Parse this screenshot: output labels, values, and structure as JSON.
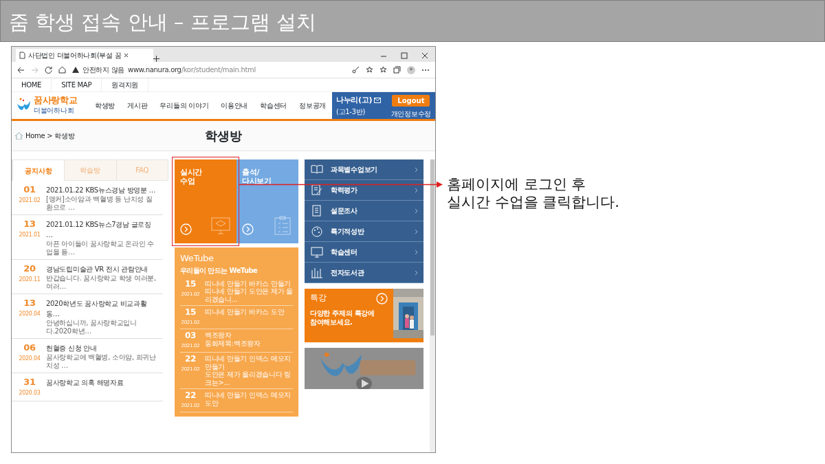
{
  "slide_title": "줌 학생 접속 안내 – 프로그램 설치",
  "callout": {
    "lines": [
      "홈페이지에 로그인 후",
      "실시간 수업을 클릭합니다."
    ]
  },
  "browser": {
    "tab_title": "사단법인 더불어하나회(부설 꿈",
    "security": "안전하지 않음",
    "url_host": "www.nanura.org",
    "url_path": "/kor/student/main.html"
  },
  "site": {
    "top_links": [
      "HOME",
      "SITE MAP",
      "원격지원"
    ],
    "logo": "꿈사랑학교",
    "logo_sub": "더불어하나회",
    "nav": [
      "학생방",
      "게시판",
      "우리들의 이야기",
      "이용안내",
      "학습센터",
      "정보공개"
    ],
    "user": {
      "name": "나누리(고)",
      "grade": "(고1-3반)",
      "logout": "Logout",
      "profile": "개인정보수정"
    }
  },
  "breadcrumb": {
    "home": "Home",
    "separator": ">",
    "current": "학생방"
  },
  "page_title": "학생방",
  "notice_tabs": [
    {
      "label": "공지사항",
      "selected": true
    },
    {
      "label": "학습방",
      "selected": false
    },
    {
      "label": "FAQ",
      "selected": false
    }
  ],
  "notices": [
    {
      "day": "01",
      "month": "2021.02",
      "title": "2021.01.22 KBS뉴스경남 방영분 …",
      "summary": "[앵커]소아암과 백혈병 등 난치성 질환으로 …"
    },
    {
      "day": "13",
      "month": "2021.01",
      "title": "2021.01.12 KBS뉴스7경남 글로징 …",
      "summary": "아픈 아이들이 꿈사랑학교 온라인 수업을 듣…"
    },
    {
      "day": "20",
      "month": "2020.11",
      "title": "경남도립미술관 VR 전시 관람안내",
      "summary": "반갑습니다. 꿈사랑학교 학생 여러분,  여러…"
    },
    {
      "day": "13",
      "month": "2020.04",
      "title": "2020학년도 꿈사랑학교 비교과활동…",
      "summary": "안녕하십니까, 꿈사랑학교입니다.2020학년…"
    },
    {
      "day": "06",
      "month": "2020.04",
      "title": "헌혈증 신청 안내",
      "summary": "꿈사랑학교에 백혈병, 소아암, 희귀난치성 …"
    },
    {
      "day": "31",
      "month": "2020.03",
      "title": "꿈사랑학교 의혹 해명자료"
    }
  ],
  "tiles": [
    {
      "title": "실시간\n수업",
      "kind": "live",
      "color": "#f07d0f",
      "highlighted": true
    },
    {
      "title": "출석/\n다시보기",
      "kind": "attendance",
      "color": "#74a9e1",
      "highlighted": false
    }
  ],
  "wetube": {
    "title": "WeTube",
    "subtitle": "우리들이 만드는 WeTube",
    "items": [
      {
        "day": "15",
        "month": "2021.02",
        "title": "띠니네 만들기 바카스 만들기",
        "summary": "띠니네 만들기 도안은 제가 올리겠습니..."
      },
      {
        "day": "15",
        "month": "2021.02",
        "title": "띠니네 만들기 바카스 도안"
      },
      {
        "day": "03",
        "month": "2021.02",
        "title": "백조왕자",
        "summary": "동화제목:백조왕자"
      },
      {
        "day": "22",
        "month": "2021.02",
        "title": "띠니네 만들기 인덱스 메모지 만들기",
        "summary": "도안은 제가 올리겠습니다 링크는>..."
      },
      {
        "day": "22",
        "month": "2021.02",
        "title": "띠니네 만들기 인덱스 메모지 도안"
      }
    ]
  },
  "menu": [
    {
      "label": "과목별수업보기",
      "kind": "book"
    },
    {
      "label": "학력평가",
      "kind": "test"
    },
    {
      "label": "설문조사",
      "kind": "survey"
    },
    {
      "label": "특기적성반",
      "kind": "palette"
    },
    {
      "label": "학습센터",
      "kind": "monitor"
    },
    {
      "label": "전자도서관",
      "kind": "library"
    }
  ],
  "special": {
    "title": "특강",
    "text": "다양한 주제의 특강에\n참여해보세요."
  }
}
